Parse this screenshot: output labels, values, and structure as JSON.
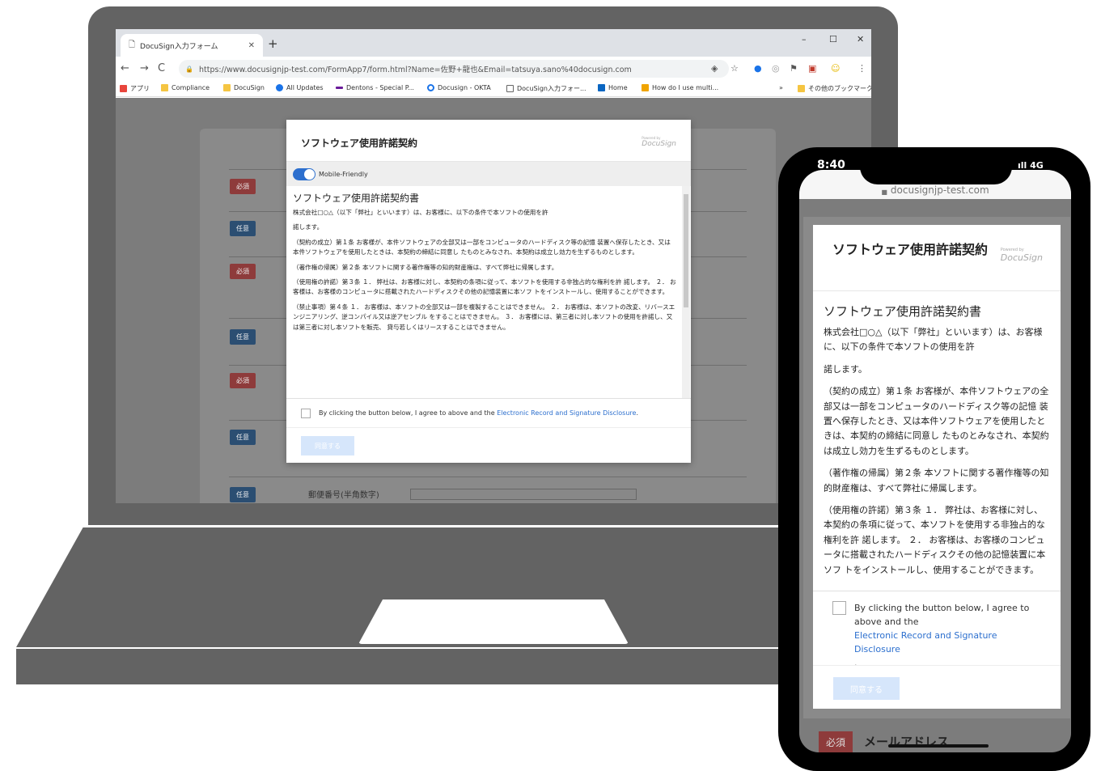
{
  "browser": {
    "tab_title": "DocuSign入力フォーム",
    "tab_close": "✕",
    "new_tab": "+",
    "win_min": "–",
    "win_max": "☐",
    "win_close": "✕",
    "url": "https://www.docusignjp-test.com/FormApp7/form.html?Name=佐野+龍也&Email=tatsuya.sano%40docusign.com",
    "bookmarks": [
      "アプリ",
      "Compliance",
      "DocuSign",
      "All Updates",
      "Dentons - Special P...",
      "Docusign - OKTA",
      "DocuSign入力フォー...",
      "Home",
      "How do I use multi..."
    ],
    "bookmark_more": "»",
    "other_bookmarks": "その他のブックマーク"
  },
  "form": {
    "badges": [
      "必須",
      "任意",
      "必須",
      "任意",
      "必須",
      "任意",
      "任意"
    ],
    "postal_label": "郵便番号(半角数字)"
  },
  "modal": {
    "title": "ソフトウェア使用許諾契約",
    "logo_small": "Powered by",
    "logo": "DocuSign",
    "mobile_friendly": "Mobile-Friendly",
    "doc_heading": "ソフトウェア使用許諾契約書",
    "doc_paragraphs": [
      "株式会社□○△（以下「弊社」といいます）は、お客様に、以下の条件で本ソフトの使用を許",
      "諾します。",
      "（契約の成立）第１条 お客様が、本件ソフトウェアの全部又は一部をコンピュータのハードディスク等の記憶 装置へ保存したとき、又は本件ソフトウェアを使用したときは、本契約の締結に同意し たものとみなされ、本契約は成立し効力を生ずるものとします。",
      "（著作権の帰属）第２条 本ソフトに関する著作権等の知的財産権は、すべて弊社に帰属します。",
      "（使用権の許諾）第３条 １． 弊社は、お客様に対し、本契約の条項に従って、本ソフトを使用する非独占的な権利を許 諾します。 ２． お客様は、お客様のコンピュータに搭載されたハードディスクその他の記憶装置に本ソフ トをインストールし、使用することができます。",
      "（禁止事項）第４条 １． お客様は、本ソフトの全部又は一部を複製することはできません。 ２． お客様は、本ソフトの改変、リバースエンジニアリング、逆コンパイル又は逆アセンブル をすることはできません。 ３． お客様には、第三者に対し本ソフトの使用を許諾し、又は第三者に対し本ソフトを販売、 貸与若しくはリースすることはできません。"
    ],
    "agree_text": "By clicking the button below, I agree to above and the ",
    "agree_link": "Electronic Record and Signature Disclosure",
    "agree_period": ".",
    "agree_button": "同意する"
  },
  "phone": {
    "time": "8:40",
    "signal": "4G",
    "url": "docusignjp-test.com",
    "title": "ソフトウェア使用許諾契約",
    "logo_small": "Powered by",
    "logo": "DocuSign",
    "doc_heading": "ソフトウェア使用許諾契約書",
    "doc_paragraphs": [
      "株式会社□○△（以下「弊社」といいます）は、お客様に、以下の条件で本ソフトの使用を許",
      "諾します。",
      "（契約の成立）第１条 お客様が、本件ソフトウェアの全部又は一部をコンピュータのハードディスク等の記憶 装置へ保存したとき、又は本件ソフトウェアを使用したときは、本契約の締結に同意し たものとみなされ、本契約は成立し効力を生ずるものとします。",
      "（著作権の帰属）第２条 本ソフトに関する著作権等の知的財産権は、すべて弊社に帰属します。",
      "（使用権の許諾）第３条 １． 弊社は、お客様に対し、本契約の条項に従って、本ソフトを使用する非独占的な権利を許 諾します。 ２． お客様は、お客様のコンピュータに搭載されたハードディスクその他の記憶装置に本ソフ トをインストールし、使用することができます。"
    ],
    "agree_text": "By clicking the button below, I agree to above and the",
    "agree_link": "Electronic Record and Signature Disclosure",
    "agree_period": ".",
    "agree_button": "同意する",
    "required_badge": "必須",
    "email_label": "メールアドレス"
  }
}
